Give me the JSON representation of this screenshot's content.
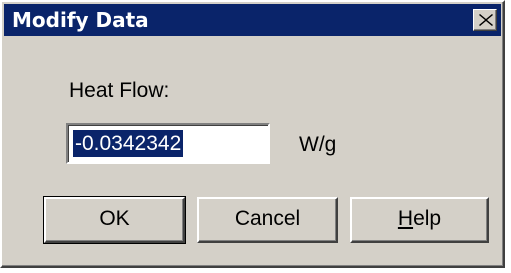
{
  "dialog": {
    "title": "Modify Data"
  },
  "form": {
    "label": "Heat Flow:",
    "value": "-0.0342342",
    "unit": "W/g"
  },
  "buttons": {
    "ok": "OK",
    "cancel": "Cancel",
    "help_mnemonic": "H",
    "help_rest": "elp"
  },
  "icons": {
    "close": "close-icon"
  },
  "colors": {
    "titlebar": "#0a246a",
    "face": "#d4d0c8",
    "selection": "#0a246a"
  }
}
